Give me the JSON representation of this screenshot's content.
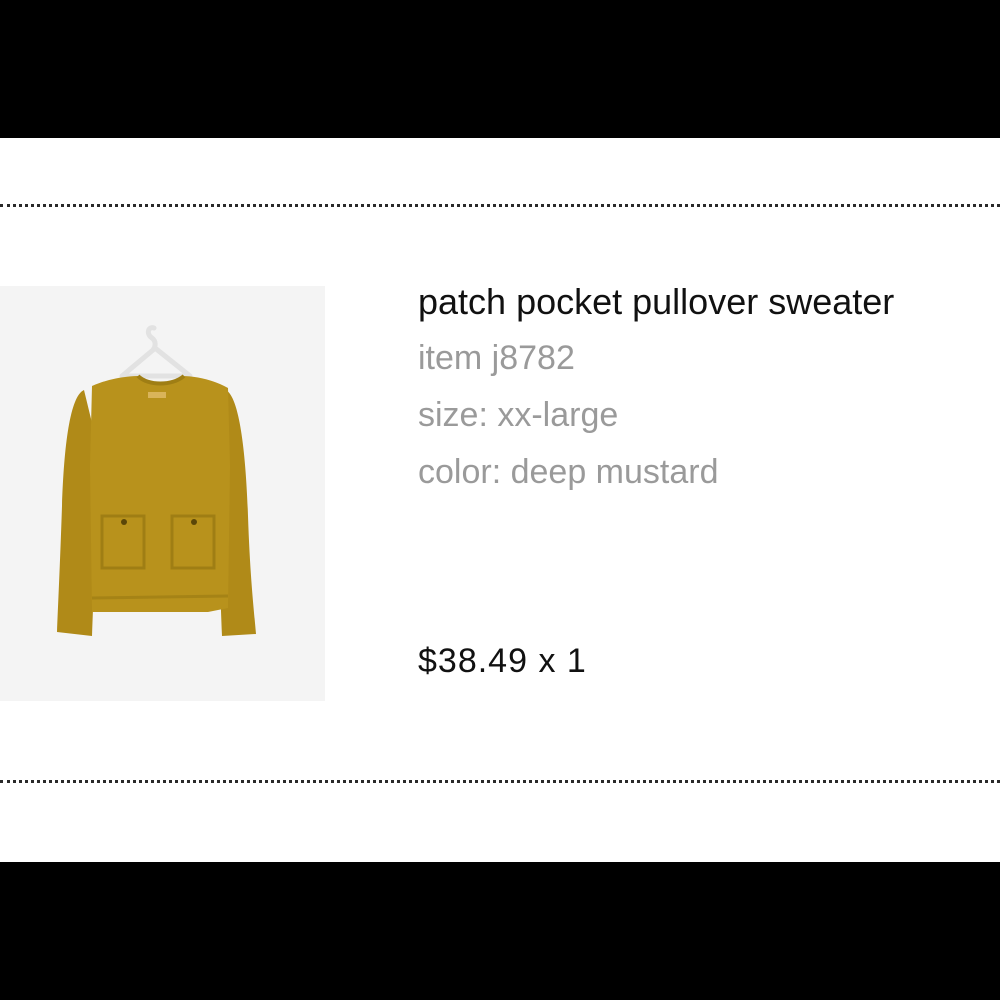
{
  "cart_item": {
    "image_alt": "patch pocket pullover sweater in deep mustard on hanger",
    "title": "patch pocket pullover sweater",
    "item_number": "item j8782",
    "size": "size: xx-large",
    "color": "color: deep mustard",
    "price_quantity": "$38.49 x 1",
    "swatch_color": "#b8921c"
  },
  "colors": {
    "letterbox": "#000000",
    "background": "#ffffff",
    "image_background": "#f4f4f4",
    "title_text": "#111111",
    "meta_text": "#9a9a9a"
  }
}
